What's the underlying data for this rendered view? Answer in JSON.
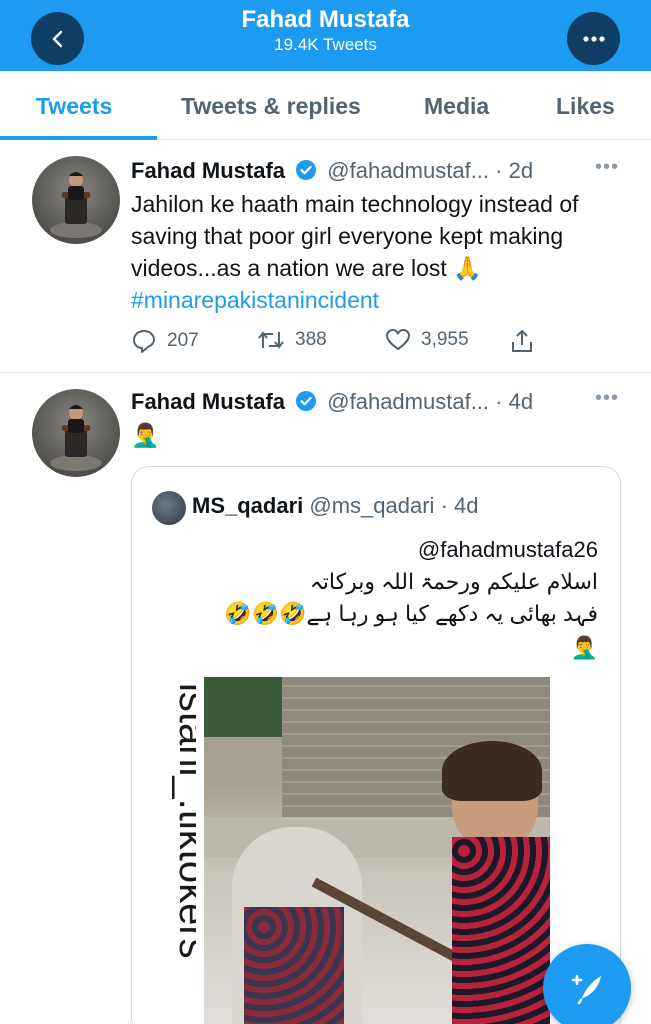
{
  "header": {
    "title": "Fahad Mustafa",
    "subtitle": "19.4K Tweets",
    "back_icon": "chevron-left-icon",
    "more_icon": "more-icon"
  },
  "tabs": [
    {
      "label": "Tweets",
      "active": true
    },
    {
      "label": "Tweets & replies",
      "active": false
    },
    {
      "label": "Media",
      "active": false
    },
    {
      "label": "Likes",
      "active": false
    }
  ],
  "tweets": [
    {
      "name": "Fahad Mustafa",
      "handle": "@fahadmustaf...",
      "time": "· 2d",
      "text": "Jahilon ke haath main technology instead of saving that poor girl everyone kept making videos...as a nation we are lost 🙏",
      "hashtag": "#minarepakistanincident",
      "replies": "207",
      "retweets": "388",
      "likes": "3,955"
    },
    {
      "name": "Fahad Mustafa",
      "handle": "@fahadmustaf...",
      "time": "· 4d",
      "text": "🤦‍♂️",
      "quote": {
        "name": "MS_qadari",
        "handle": "@ms_qadari",
        "time": "· 4d",
        "lines": [
          "@fahadmustafa26",
          "اسلام علیکم ورحمۃ اللہ وبرکاتہ",
          "🤣🤣🤣فہد بھائی یہ دکھے کیا ہو رہا ہے",
          "🤦‍♂️"
        ],
        "watermark": "istani_.tiktokers"
      }
    }
  ],
  "colors": {
    "accent": "#1d9bf0",
    "verified": "#1d9bf0",
    "muted": "#536471"
  },
  "fab_icon": "compose-tweet-icon"
}
